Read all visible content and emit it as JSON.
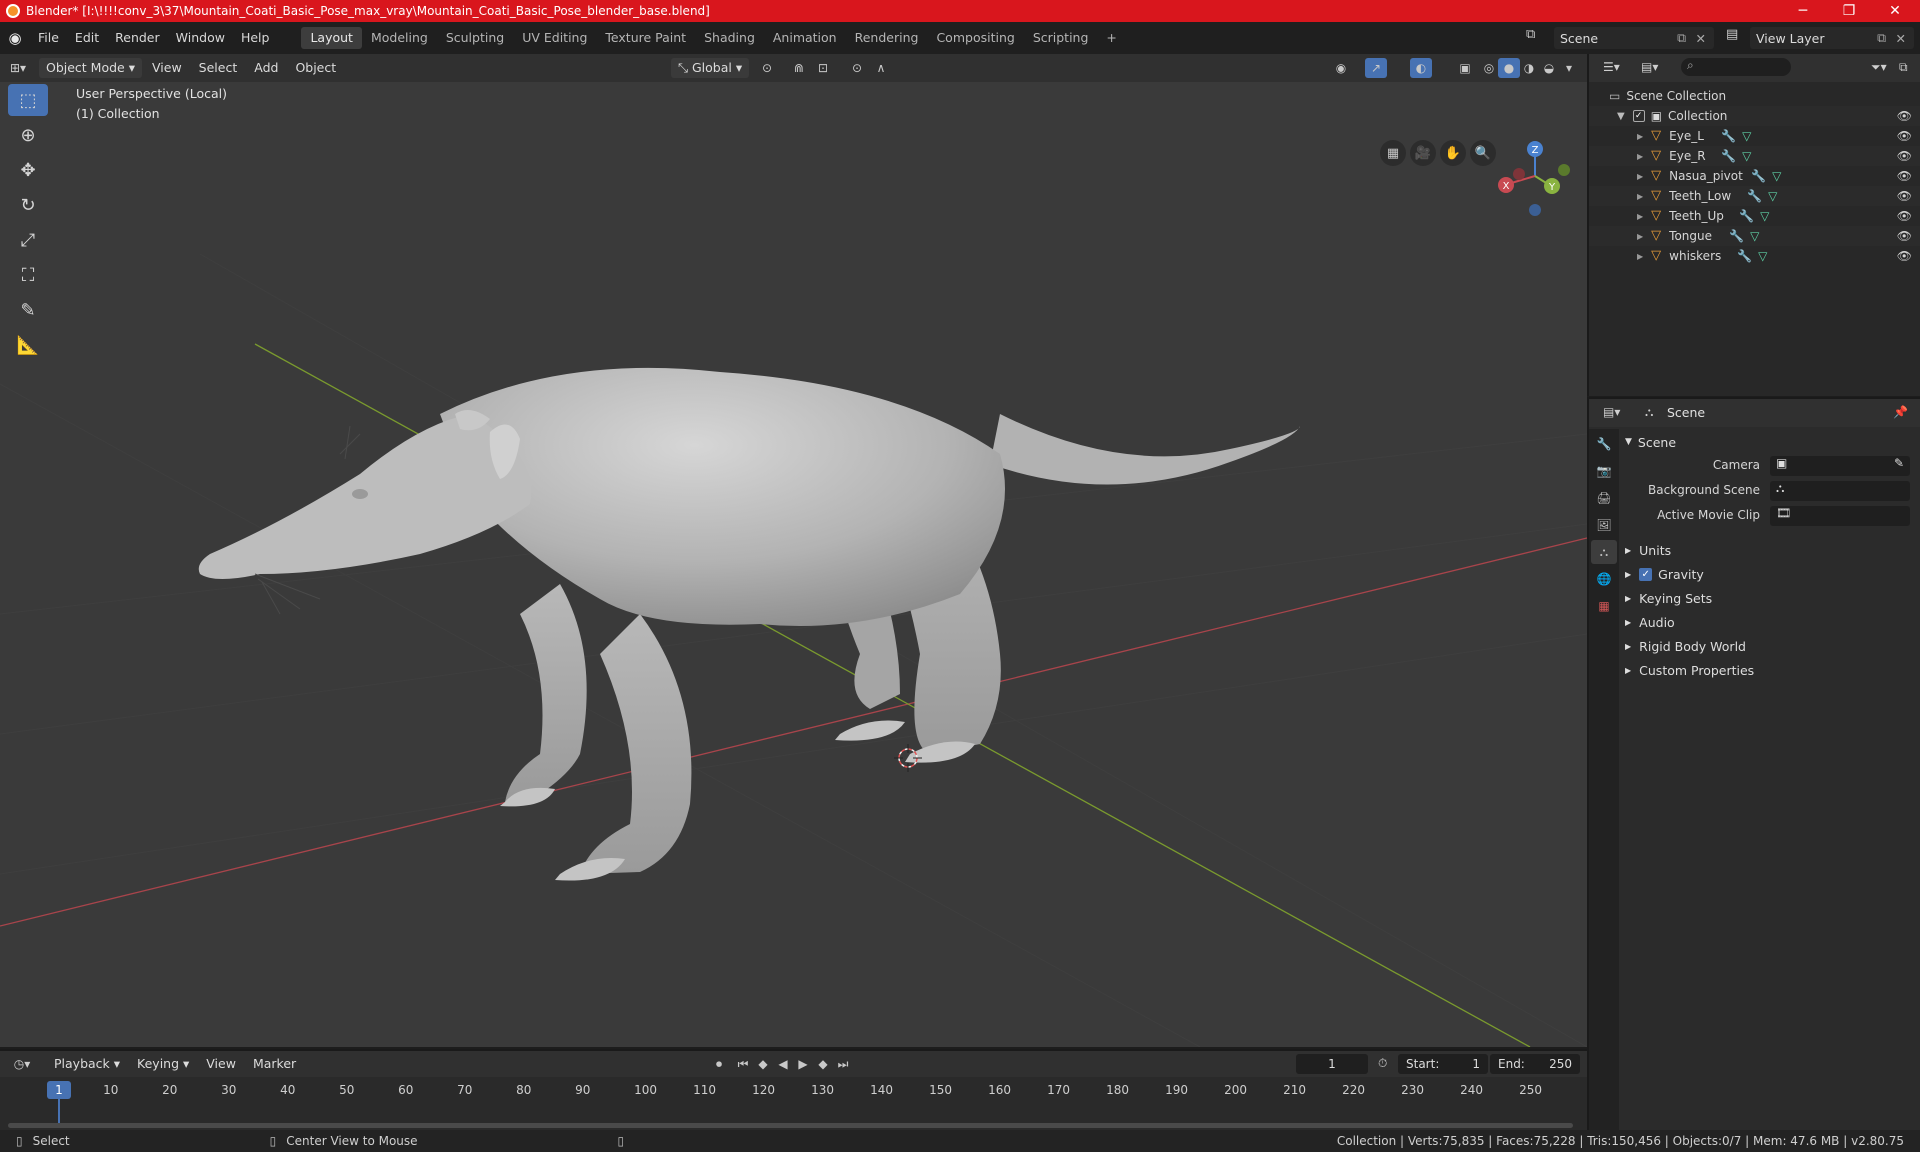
{
  "window": {
    "title": "Blender* [I:\\!!!!conv_3\\37\\Mountain_Coati_Basic_Pose_max_vray\\Mountain_Coati_Basic_Pose_blender_base.blend]",
    "minimize": "─",
    "maximize": "❐",
    "close": "✕"
  },
  "menu": {
    "file": "File",
    "edit": "Edit",
    "render": "Render",
    "window": "Window",
    "help": "Help"
  },
  "workspaces": [
    "Layout",
    "Modeling",
    "Sculpting",
    "UV Editing",
    "Texture Paint",
    "Shading",
    "Animation",
    "Rendering",
    "Compositing",
    "Scripting"
  ],
  "topbar": {
    "scene": "Scene",
    "view_layer": "View Layer",
    "add_workspace": "+"
  },
  "viewport": {
    "mode": "Object Mode",
    "view": "View",
    "select": "Select",
    "add": "Add",
    "object": "Object",
    "orientation": "Global",
    "perspective_label": "User Perspective (Local)",
    "collection_label": "(1) Collection",
    "gizmo_x": "X",
    "gizmo_y": "Y",
    "gizmo_z": "Z"
  },
  "outliner": {
    "scene_collection": "Scene Collection",
    "collection": "Collection",
    "objects": [
      "Eye_L",
      "Eye_R",
      "Nasua_pivot",
      "Teeth_Low",
      "Teeth_Up",
      "Tongue",
      "whiskers"
    ]
  },
  "properties": {
    "context": "Scene",
    "panel": "Scene",
    "camera_label": "Camera",
    "background_scene_label": "Background Scene",
    "active_movie_clip_label": "Active Movie Clip",
    "sections": [
      "Units",
      "Gravity",
      "Keying Sets",
      "Audio",
      "Rigid Body World",
      "Custom Properties"
    ],
    "gravity_checked": true
  },
  "timeline": {
    "playback": "Playback",
    "keying": "Keying",
    "view": "View",
    "marker": "Marker",
    "current_frame": "1",
    "start_label": "Start:",
    "start_value": "1",
    "end_label": "End:",
    "end_value": "250",
    "ruler": [
      "1",
      "10",
      "20",
      "30",
      "40",
      "50",
      "60",
      "70",
      "80",
      "90",
      "100",
      "110",
      "120",
      "130",
      "140",
      "150",
      "160",
      "170",
      "180",
      "190",
      "200",
      "210",
      "220",
      "230",
      "240",
      "250"
    ]
  },
  "statusbar": {
    "select": "Select",
    "center_view": "Center View to Mouse",
    "stats": "Collection | Verts:75,835 | Faces:75,228 | Tris:150,456 | Objects:0/7 | Mem: 47.6 MB | v2.80.75"
  },
  "colors": {
    "accent": "#4772b3",
    "titlebar": "#d9161d",
    "x_axis": "#c84a52",
    "y_axis": "#8ab340",
    "z_axis": "#4a82d0"
  }
}
